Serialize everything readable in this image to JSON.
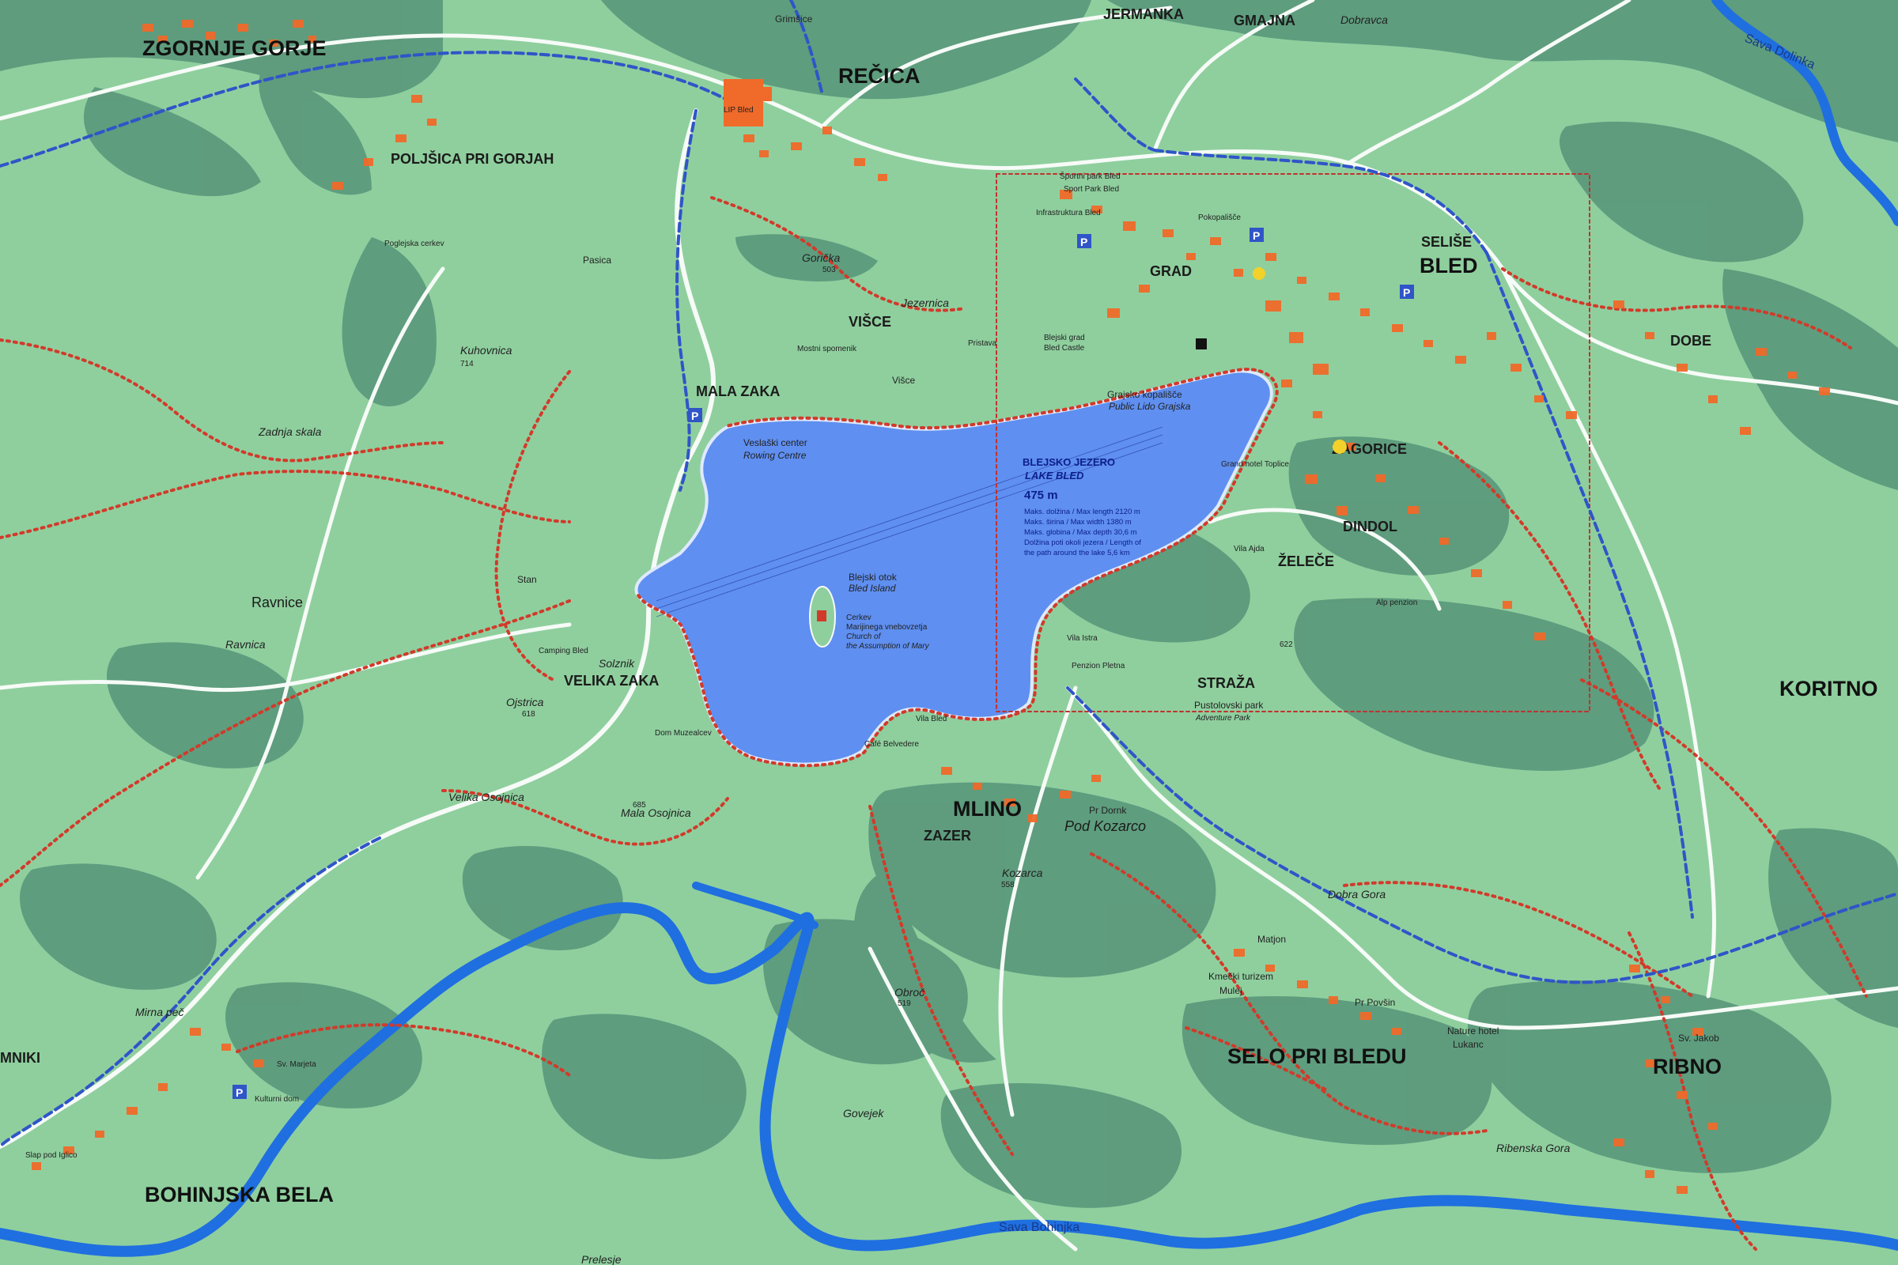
{
  "map": {
    "colors": {
      "meadow": "#8fcf9e",
      "forest": "#5c9a7c",
      "lake": "#5f8ff0",
      "river": "#1f6fe0",
      "road": "#f6fbf7",
      "trail": "#d23a2a",
      "cycle_route": "#2f55c8",
      "building": "#f06a2a",
      "district_border": "#c0322f"
    },
    "towns": {
      "zgornje_gorje": "ZGORNJE GORJE",
      "recica": "REČICA",
      "bled": "BLED",
      "mlino": "MLINO",
      "selo_pri_bledu": "SELO PRI BLEDU",
      "ribno": "RIBNO",
      "koritno": "KORITNO",
      "bohinjska_bela": "BOHINJSKA BELA"
    },
    "villages": {
      "jermanka": "JERMANKA",
      "gmajna": "GMAJNA",
      "polj_gorjah": "POLJŠICA PRI GORJAH",
      "mala_zaka": "MALA ZAKA",
      "velika_zaka": "VELIKA ZAKA",
      "grad": "GRAD",
      "selise": "SELIŠE",
      "zagorice": "ZAGORICE",
      "dobe": "DOBE",
      "dindol": "DINDOL",
      "zelece": "ŽELEČE",
      "straza": "STRAŽA",
      "zazer": "ZAZER",
      "visce": "VIŠCE",
      "mniki": "MNIKI"
    },
    "places": {
      "dobravca": "Dobravca",
      "grimsice": "Grimšice",
      "pasica": "Pasica",
      "goricka": "Gorička",
      "visce_small": "Višce",
      "kuhovnica": "Kuhovnica",
      "zadnja_skala": "Zadnja skala",
      "stan": "Stan",
      "ravnice": "Ravnice",
      "ravnica": "Ravnica",
      "ojstrica": "Ojstrica",
      "velika_osojnica": "Velika Osojnica",
      "mala_osojnica": "Mala Osojnica",
      "pod_kozarco": "Pod Kozarco",
      "kozarca": "Kozarca",
      "dobra_gora": "Dobra Gora",
      "matjon": "Matjon",
      "govejek": "Govejek",
      "obroc": "Obroč",
      "mirna_pec": "Mirna peč",
      "prelesje": "Prelesje",
      "ribenska_gora": "Ribenska Gora",
      "kmecki_turizem": "Kmečki turizem",
      "mulej": "Mulej",
      "pr_povsin": "Pr Povšin",
      "nature_hotel": "Nature hotel",
      "lukanc": "Lukanc",
      "sv_jakob": "Sv. Jakob",
      "pr_dornk": "Pr Dornk",
      "vila_bled": "Vila Bled",
      "cafe_belvedere": "Café Belvedere",
      "camping_bled": "Camping Bled",
      "solznik": "Solznik",
      "dom_muzealcev": "Dom Muzealcev",
      "sportni_park": "Športni park Bled",
      "sport_park": "Sport Park Bled",
      "infrastruktura": "Infrastruktura Bled",
      "lip_bled": "LIP Bled",
      "pokopalisce": "Pokopališče",
      "slap": "Slap pod Iglico",
      "kulturni_dom": "Kulturni dom",
      "sv_marjeta": "Sv. Marjeta",
      "penzion_pletna": "Penzion Pletna",
      "vila_istra": "Vila Istra",
      "alp_penzion": "Alp penzion",
      "blejski_grad": "Blejski grad",
      "bled_castle": "Bled Castle",
      "grajsko_kopalisce": "Grajsko kopališče",
      "public_lido": "Public Lido Grajska",
      "veslaski_center": "Veslaški center",
      "rowing_centre": "Rowing Centre",
      "blejski_otok": "Blejski otok",
      "bled_island": "Bled Island",
      "cerkev": "Cerkev",
      "marijinega": "Marijinega vnebovzetja",
      "church": "Church of",
      "assumption": "the Assumption of Mary",
      "pustolovski_park": "Pustolovski park",
      "adventure_park": "Adventure Park",
      "polj_cerkev": "Poglejska cerkev",
      "mostni_spomenik": "Mostni spomenik",
      "jezernica": "Jezernica",
      "pristava": "Pristava",
      "grand_hotel": "Grand hotel Toplice",
      "vila_ajda": "Vila Ajda"
    },
    "lake": {
      "name": "BLEJSKO JEZERO",
      "name_en": "LAKE BLED",
      "elevation": "475 m",
      "stats": [
        "Maks. dolžina / Max length 2120 m",
        "Maks. širina / Max width 1380 m",
        "Maks. globina / Max depth 30,6 m",
        "Dolžina poti okoli jezera / Length of",
        "the path around the lake 5,6 km"
      ]
    },
    "rivers": {
      "sava_dolinka": "Sava Dolinka",
      "sava_bohinjka": "Sava Bohinjka"
    },
    "elevations": {
      "e714": "714",
      "e618": "618",
      "e685": "685",
      "e558": "558",
      "e519": "519",
      "e622": "622",
      "e503": "503"
    }
  }
}
